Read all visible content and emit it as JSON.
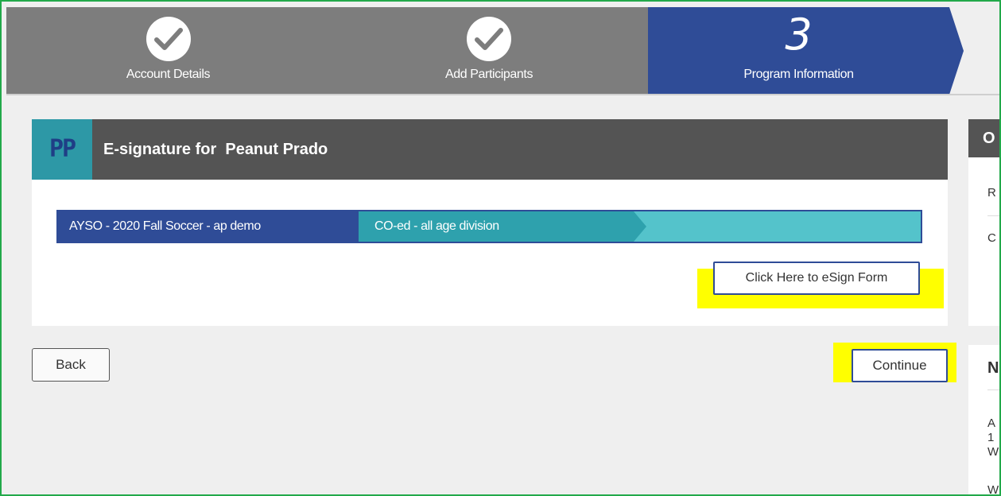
{
  "stepper": {
    "steps": [
      {
        "label": "Account Details",
        "state": "complete",
        "icon": "check-icon"
      },
      {
        "label": "Add Participants",
        "state": "complete",
        "icon": "check-icon"
      },
      {
        "label": "Program Information",
        "state": "current",
        "number": "3"
      }
    ]
  },
  "card": {
    "avatar_initials": "PP",
    "title": "E-signature for  Peanut Prado",
    "breadcrumb": [
      "AYSO - 2020 Fall Soccer - ap demo",
      "CO-ed - all age division"
    ],
    "esign_button": "Click Here to eSign Form"
  },
  "actions": {
    "back": "Back",
    "continue": "Continue"
  },
  "side_panel_top": {
    "header": "O",
    "row1": "R",
    "row2": "C"
  },
  "side_panel_bottom": {
    "header": "N",
    "line1": "A",
    "line2": "1",
    "line3": "W",
    "line4": "W"
  },
  "colors": {
    "step_complete": "#7d7d7d",
    "step_current": "#2f4c97",
    "breadcrumb_primary": "#2f4c97",
    "breadcrumb_secondary": "#2ea1ad",
    "breadcrumb_track": "#54c3cb",
    "avatar_bg": "#2d98a6",
    "highlight": "#ffff00"
  }
}
